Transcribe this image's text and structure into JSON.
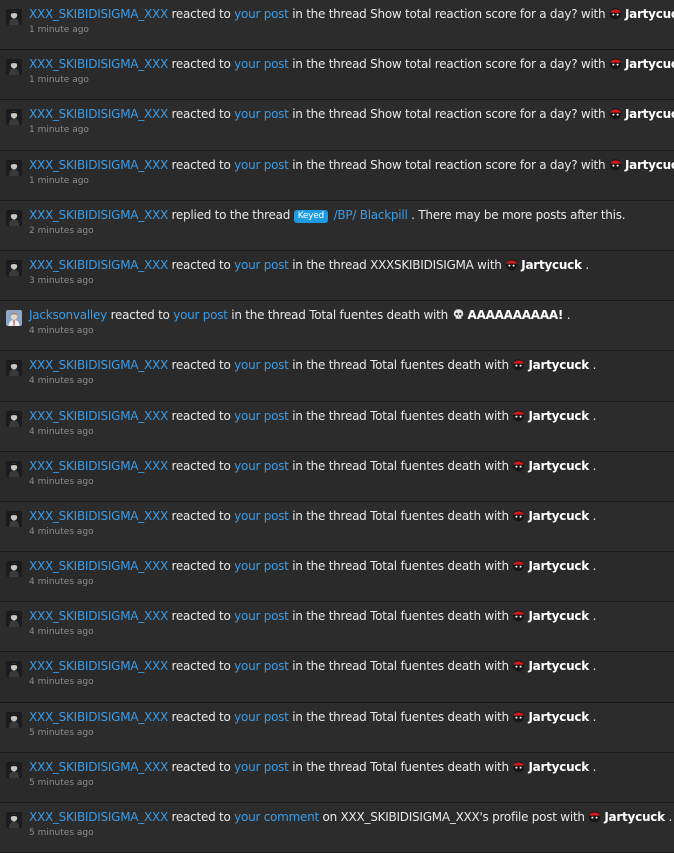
{
  "colors": {
    "background": "#2a2a2b",
    "link": "#3b9ce6",
    "text": "#e8e8e8",
    "time": "#8d8d8d",
    "prefix": "#1f9ce0"
  },
  "alerts": [
    {
      "kind": "reaction",
      "avatar": "dark",
      "user": "XXX_SKIBIDISIGMA_XXX",
      "verb": "reacted to",
      "target": "your post",
      "context": "in the thread Show total reaction score for a day? with",
      "reaction_icon": "red-faced-emoji-icon",
      "reaction": "Jartycuck",
      "end": ".",
      "time": "1 minute ago"
    },
    {
      "kind": "reaction",
      "avatar": "dark",
      "user": "XXX_SKIBIDISIGMA_XXX",
      "verb": "reacted to",
      "target": "your post",
      "context": "in the thread Show total reaction score for a day? with",
      "reaction_icon": "red-faced-emoji-icon",
      "reaction": "Jartycuck",
      "end": ".",
      "time": "1 minute ago"
    },
    {
      "kind": "reaction",
      "avatar": "dark",
      "user": "XXX_SKIBIDISIGMA_XXX",
      "verb": "reacted to",
      "target": "your post",
      "context": "in the thread Show total reaction score for a day? with",
      "reaction_icon": "red-faced-emoji-icon",
      "reaction": "Jartycuck",
      "end": ".",
      "time": "1 minute ago"
    },
    {
      "kind": "reaction",
      "avatar": "dark",
      "user": "XXX_SKIBIDISIGMA_XXX",
      "verb": "reacted to",
      "target": "your post",
      "context": "in the thread Show total reaction score for a day? with",
      "reaction_icon": "red-faced-emoji-icon",
      "reaction": "Jartycuck",
      "end": ".",
      "time": "1 minute ago"
    },
    {
      "kind": "reply",
      "avatar": "dark",
      "user": "XXX_SKIBIDISIGMA_XXX",
      "verb": "replied to the thread",
      "prefix": "Keyed",
      "thread": "/BP/ Blackpill",
      "end": ". There may be more posts after this.",
      "time": "2 minutes ago"
    },
    {
      "kind": "reaction",
      "avatar": "dark",
      "user": "XXX_SKIBIDISIGMA_XXX",
      "verb": "reacted to",
      "target": "your post",
      "context": "in the thread XXXSKIBIDISIGMA with",
      "reaction_icon": "red-faced-emoji-icon",
      "reaction": "Jartycuck",
      "end": ".",
      "time": "3 minutes ago"
    },
    {
      "kind": "reaction",
      "avatar": "light",
      "user": "Jacksonvalley",
      "verb": "reacted to",
      "target": "your post",
      "context": "in the thread Total fuentes death with",
      "reaction_icon": "skull-icon",
      "reaction": "AAAAAAAAAA!",
      "end": ".",
      "time": "4 minutes ago"
    },
    {
      "kind": "reaction",
      "avatar": "dark",
      "user": "XXX_SKIBIDISIGMA_XXX",
      "verb": "reacted to",
      "target": "your post",
      "context": "in the thread Total fuentes death with",
      "reaction_icon": "red-faced-emoji-icon",
      "reaction": "Jartycuck",
      "end": ".",
      "time": "4 minutes ago"
    },
    {
      "kind": "reaction",
      "avatar": "dark",
      "user": "XXX_SKIBIDISIGMA_XXX",
      "verb": "reacted to",
      "target": "your post",
      "context": "in the thread Total fuentes death with",
      "reaction_icon": "red-faced-emoji-icon",
      "reaction": "Jartycuck",
      "end": ".",
      "time": "4 minutes ago"
    },
    {
      "kind": "reaction",
      "avatar": "dark",
      "user": "XXX_SKIBIDISIGMA_XXX",
      "verb": "reacted to",
      "target": "your post",
      "context": "in the thread Total fuentes death with",
      "reaction_icon": "red-faced-emoji-icon",
      "reaction": "Jartycuck",
      "end": ".",
      "time": "4 minutes ago"
    },
    {
      "kind": "reaction",
      "avatar": "dark",
      "user": "XXX_SKIBIDISIGMA_XXX",
      "verb": "reacted to",
      "target": "your post",
      "context": "in the thread Total fuentes death with",
      "reaction_icon": "red-faced-emoji-icon",
      "reaction": "Jartycuck",
      "end": ".",
      "time": "4 minutes ago"
    },
    {
      "kind": "reaction",
      "avatar": "dark",
      "user": "XXX_SKIBIDISIGMA_XXX",
      "verb": "reacted to",
      "target": "your post",
      "context": "in the thread Total fuentes death with",
      "reaction_icon": "red-faced-emoji-icon",
      "reaction": "Jartycuck",
      "end": ".",
      "time": "4 minutes ago"
    },
    {
      "kind": "reaction",
      "avatar": "dark",
      "user": "XXX_SKIBIDISIGMA_XXX",
      "verb": "reacted to",
      "target": "your post",
      "context": "in the thread Total fuentes death with",
      "reaction_icon": "red-faced-emoji-icon",
      "reaction": "Jartycuck",
      "end": ".",
      "time": "4 minutes ago"
    },
    {
      "kind": "reaction",
      "avatar": "dark",
      "user": "XXX_SKIBIDISIGMA_XXX",
      "verb": "reacted to",
      "target": "your post",
      "context": "in the thread Total fuentes death with",
      "reaction_icon": "red-faced-emoji-icon",
      "reaction": "Jartycuck",
      "end": ".",
      "time": "4 minutes ago"
    },
    {
      "kind": "reaction",
      "avatar": "dark",
      "user": "XXX_SKIBIDISIGMA_XXX",
      "verb": "reacted to",
      "target": "your post",
      "context": "in the thread Total fuentes death with",
      "reaction_icon": "red-faced-emoji-icon",
      "reaction": "Jartycuck",
      "end": ".",
      "time": "5 minutes ago"
    },
    {
      "kind": "reaction",
      "avatar": "dark",
      "user": "XXX_SKIBIDISIGMA_XXX",
      "verb": "reacted to",
      "target": "your post",
      "context": "in the thread Total fuentes death with",
      "reaction_icon": "red-faced-emoji-icon",
      "reaction": "Jartycuck",
      "end": ".",
      "time": "5 minutes ago"
    },
    {
      "kind": "reaction",
      "avatar": "dark",
      "user": "XXX_SKIBIDISIGMA_XXX",
      "verb": "reacted to",
      "target": "your comment",
      "context": "on XXX_SKIBIDISIGMA_XXX's profile post with",
      "reaction_icon": "red-faced-emoji-icon",
      "reaction": "Jartycuck",
      "end": ".",
      "time": "5 minutes ago"
    }
  ]
}
